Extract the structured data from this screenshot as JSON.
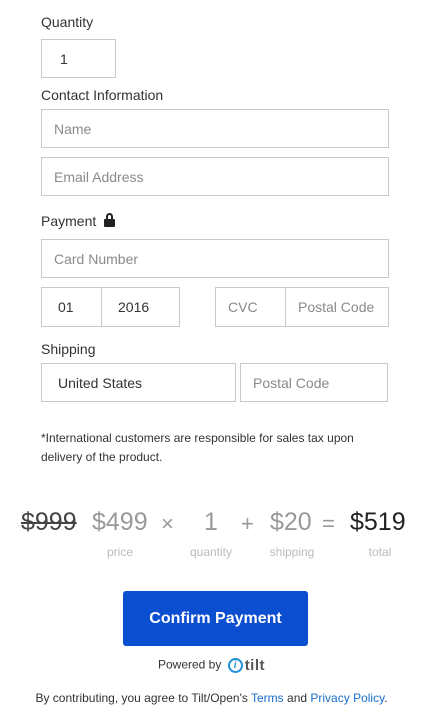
{
  "quantity": {
    "label": "Quantity",
    "value": "1"
  },
  "contact": {
    "label": "Contact Information",
    "name_placeholder": "Name",
    "email_placeholder": "Email Address"
  },
  "payment": {
    "label": "Payment",
    "icon": "lock-icon",
    "card_placeholder": "Card Number",
    "exp_month": "01",
    "exp_year": "2016",
    "cvc_placeholder": "CVC",
    "postal_placeholder": "Postal Code"
  },
  "shipping": {
    "label": "Shipping",
    "country": "United States",
    "postal_placeholder": "Postal Code"
  },
  "note": "*International customers are responsible for sales tax upon delivery of the product.",
  "summary": {
    "original_price": "$999",
    "price": "$499",
    "price_caption": "price",
    "times_op": "×",
    "quantity": "1",
    "quantity_caption": "quantity",
    "plus_op": "+",
    "shipping": "$20",
    "shipping_caption": "shipping",
    "equals_op": "=",
    "total": "$519",
    "total_caption": "total"
  },
  "confirm_label": "Confirm Payment",
  "powered_by": "Powered by",
  "brand": {
    "mark": "i",
    "name": "tilt",
    "icon": "tilt-logo-icon",
    "color": "#1f8fdc"
  },
  "legal": {
    "prefix": "By contributing, you agree to Tilt/Open's",
    "terms": "Terms",
    "and": "and",
    "privacy": "Privacy Policy",
    "suffix": "."
  },
  "colors": {
    "accent": "#0c4ed0",
    "link": "#1a6fc9"
  }
}
